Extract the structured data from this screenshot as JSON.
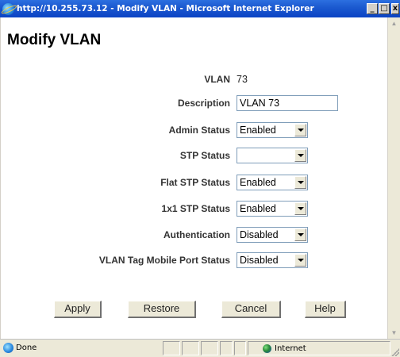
{
  "window": {
    "title": "http://10.255.73.12 - Modify VLAN - Microsoft Internet Explorer",
    "minimize_glyph": "_",
    "maximize_glyph": "□",
    "close_glyph": "x"
  },
  "page": {
    "title": "Modify VLAN"
  },
  "form": {
    "vlan": {
      "label": "VLAN",
      "value": "73"
    },
    "description": {
      "label": "Description",
      "value": "VLAN 73"
    },
    "admin_status": {
      "label": "Admin Status",
      "selected": "Enabled"
    },
    "stp_status": {
      "label": "STP Status",
      "selected": ""
    },
    "flat_stp_status": {
      "label": "Flat STP Status",
      "selected": "Enabled"
    },
    "one_x1_stp_status": {
      "label": "1x1 STP Status",
      "selected": "Enabled"
    },
    "authentication": {
      "label": "Authentication",
      "selected": "Disabled"
    },
    "vlan_tag_mobile_port_status": {
      "label": "VLAN Tag Mobile Port Status",
      "selected": "Disabled"
    }
  },
  "buttons": {
    "apply": "Apply",
    "restore": "Restore",
    "cancel": "Cancel",
    "help": "Help"
  },
  "statusbar": {
    "status": "Done",
    "zone": "Internet"
  },
  "icons": {
    "browser": "ie-logo-icon",
    "page": "page-done-icon",
    "zone": "internet-globe-icon"
  }
}
